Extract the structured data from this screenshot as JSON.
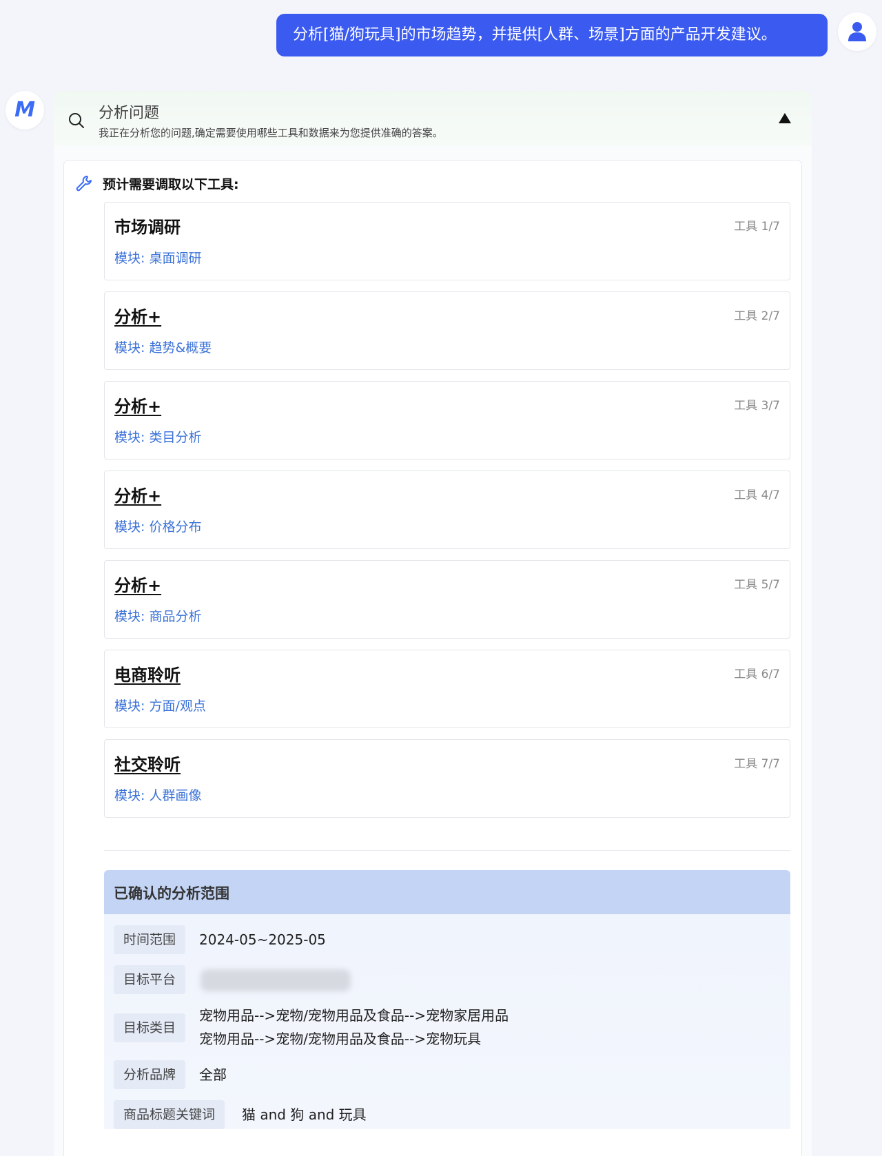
{
  "user_message": "分析[猫/狗玩具]的市场趋势，并提供[人群、场景]方面的产品开发建议。",
  "bot_logo": "M",
  "analysis": {
    "title": "分析问题",
    "subtitle": "我正在分析您的问题,确定需要使用哪些工具和数据来为您提供准确的答案。"
  },
  "tools": {
    "heading": "预计需要调取以下工具:",
    "items": [
      {
        "name": "市场调研",
        "count": "工具 1/7",
        "module": "模块: 桌面调研"
      },
      {
        "name": "分析+",
        "count": "工具 2/7",
        "module": "模块: 趋势&概要"
      },
      {
        "name": "分析+",
        "count": "工具 3/7",
        "module": "模块: 类目分析"
      },
      {
        "name": "分析+",
        "count": "工具 4/7",
        "module": "模块: 价格分布"
      },
      {
        "name": "分析+",
        "count": "工具 5/7",
        "module": "模块: 商品分析"
      },
      {
        "name": "电商聆听",
        "count": "工具 6/7",
        "module": "模块: 方面/观点"
      },
      {
        "name": "社交聆听",
        "count": "工具 7/7",
        "module": "模块: 人群画像"
      }
    ]
  },
  "scope": {
    "title": "已确认的分析范围",
    "time_label": "时间范围",
    "time_value": "2024-05~2025-05",
    "platform_label": "目标平台",
    "category_label": "目标类目",
    "category_values": [
      "宠物用品-->宠物/宠物用品及食品-->宠物家居用品",
      "宠物用品-->宠物/宠物用品及食品-->宠物玩具"
    ],
    "brand_label": "分析品牌",
    "brand_value": "全部",
    "keyword_label": "商品标题关键词",
    "keyword_value": "猫 and 狗 and 玩具"
  }
}
